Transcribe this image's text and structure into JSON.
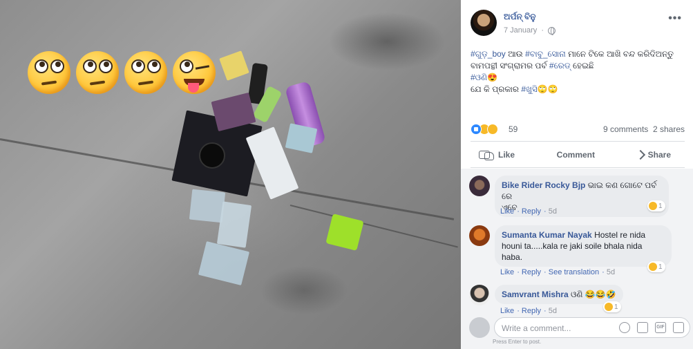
{
  "photo": {
    "description_icons": [
      "face-with-rolling-eyes-icon",
      "face-with-rolling-eyes-icon",
      "face-with-rolling-eyes-icon",
      "winking-face-with-tongue-icon"
    ]
  },
  "post": {
    "author": "ଅର୍ପନ୍ ବିନୁ",
    "date": "7 January",
    "privacy_icon": "globe-icon",
    "more_icon": "more-options-icon",
    "more_label": "•••",
    "lines": [
      [
        "#ଗୁଡ଼_boy",
        " ଆଉ ",
        "#ବାବୁ_ସୋନା",
        " ମାନେ ଟିକେ ଆଖି ବନ୍ଦ କରିଦିଅନ୍ତୁ"
      ],
      [
        "ବାମପନ୍ଥୀ ସଂଗ୍ରାମର ପର୍ବ ",
        "#ରେଡ୍",
        " ହେଇଛି"
      ],
      [
        "#ଓଣି",
        "😍"
      ],
      [
        "ଯେ କି ପ୍ରକାର ",
        "#ଖୁସି",
        "🙄🙄"
      ]
    ],
    "reactions_count": "59",
    "comments_count": "9 comments",
    "shares_count": "2 shares",
    "actions": {
      "like": "Like",
      "comment": "Comment",
      "share": "Share"
    }
  },
  "comments": [
    {
      "name": "Bike Rider Rocky Bjp",
      "text_line1": "ଭାଇ କଣ ଗୋଟେ ପର୍ବ ରେ",
      "text_line2": "ଏବେ",
      "like": "Like",
      "reply": "Reply",
      "time": "5d",
      "reaction_count": "1"
    },
    {
      "name": "Sumanta Kumar Nayak",
      "text_line1": "Hostel re nida",
      "text_line2": "houni ta.....kala re jaki soile bhala nida",
      "text_line3": "haba.",
      "like": "Like",
      "reply": "Reply",
      "translate": "See translation",
      "time": "5d",
      "reaction_count": "1"
    },
    {
      "name": "Samvrant Mishra",
      "text": "ଓଣି 😂😂🤣",
      "like": "Like",
      "reply": "Reply",
      "time": "5d",
      "reaction_count": "1"
    }
  ],
  "compose": {
    "placeholder": "Write a comment...",
    "hint": "Press Enter to post.",
    "gif_label": "GIF"
  },
  "colors": {
    "link": "#365899",
    "muted": "#90949c",
    "like_blue": "#2d88ff",
    "haha_yellow": "#f7b928"
  }
}
